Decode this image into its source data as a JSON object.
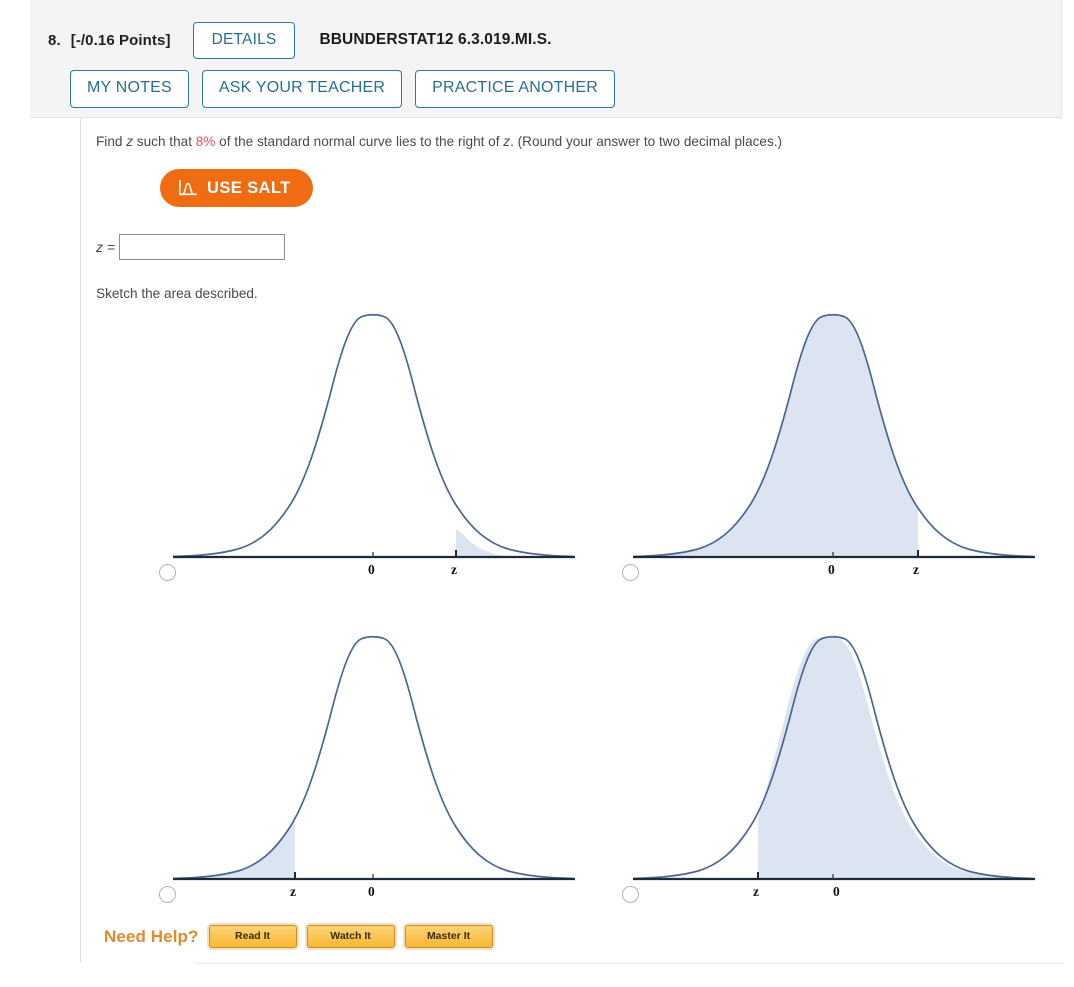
{
  "header": {
    "question_number": "8.",
    "points": "[-/0.16 Points]",
    "details_label": "DETAILS",
    "question_code": "BBUNDERSTAT12 6.3.019.MI.S.",
    "buttons": [
      {
        "label": "MY NOTES",
        "name": "my-notes-button"
      },
      {
        "label": "ASK YOUR TEACHER",
        "name": "ask-your-teacher-button"
      },
      {
        "label": "PRACTICE ANOTHER",
        "name": "practice-another-button"
      }
    ]
  },
  "body": {
    "prompt_part1": "Find ",
    "prompt_z1": "z",
    "prompt_part2": " such that ",
    "prompt_percent": "8%",
    "prompt_part3": " of the standard normal curve lies to the right of ",
    "prompt_z2": "z",
    "prompt_part4": ". (Round your answer to two decimal places.)",
    "salt_label": "USE SALT",
    "salt_icon": "normal-curve-icon",
    "z_label": "z =",
    "z_value": "",
    "z_placeholder": "",
    "sketch_label": "Sketch the area described."
  },
  "need_help": {
    "label": "Need Help?",
    "buttons": [
      {
        "label": "Read It",
        "name": "read-it-button"
      },
      {
        "label": "Watch It",
        "name": "watch-it-button"
      },
      {
        "label": "Master It",
        "name": "master-it-button"
      }
    ]
  },
  "colors": {
    "curve_stroke": "#4a6792",
    "curve_fill": "#dbe4f0",
    "salt_orange": "#ef6c13",
    "accent_teal": "#2b7a99",
    "highlight_red": "#e0525b",
    "help_gold": "#f7b733"
  },
  "chart_data": [
    {
      "id": "option-a",
      "position": "top-left",
      "type": "area",
      "title": "",
      "xlabel": "",
      "ylabel": "",
      "distribution": "standard normal",
      "mean": 0,
      "sd": 1,
      "tick_labels": [
        "0",
        "z"
      ],
      "tick_values": [
        0,
        1.41
      ],
      "shaded_region": "right tail",
      "shade_from": 1.41,
      "shade_to": 4.9,
      "shade_description": "area to the right of z, with z located right of 0",
      "selected": false
    },
    {
      "id": "option-b",
      "position": "top-right",
      "type": "area",
      "title": "",
      "xlabel": "",
      "ylabel": "",
      "distribution": "standard normal",
      "mean": 0,
      "sd": 1,
      "tick_labels": [
        "0",
        "z"
      ],
      "tick_values": [
        0,
        1.41
      ],
      "shaded_region": "left of z",
      "shade_from": -4.9,
      "shade_to": 1.41,
      "shade_description": "area to the left of z, with z located right of 0",
      "selected": false
    },
    {
      "id": "option-c",
      "position": "bottom-left",
      "type": "area",
      "title": "",
      "xlabel": "",
      "ylabel": "",
      "distribution": "standard normal",
      "mean": 0,
      "sd": 1,
      "tick_labels": [
        "z",
        "0"
      ],
      "tick_values": [
        -1.41,
        0
      ],
      "shaded_region": "left tail",
      "shade_from": -4.9,
      "shade_to": -1.41,
      "shade_description": "area to the left of z, with z located left of 0",
      "selected": false
    },
    {
      "id": "option-d",
      "position": "bottom-right",
      "type": "area",
      "title": "",
      "xlabel": "",
      "ylabel": "",
      "distribution": "standard normal",
      "mean": 0,
      "sd": 1,
      "tick_labels": [
        "z",
        "0"
      ],
      "tick_values": [
        -1.41,
        0
      ],
      "shaded_region": "right of z",
      "shade_from": -1.41,
      "shade_to": 4.9,
      "shade_description": "area to the right of z, with z located left of 0",
      "selected": false
    }
  ]
}
